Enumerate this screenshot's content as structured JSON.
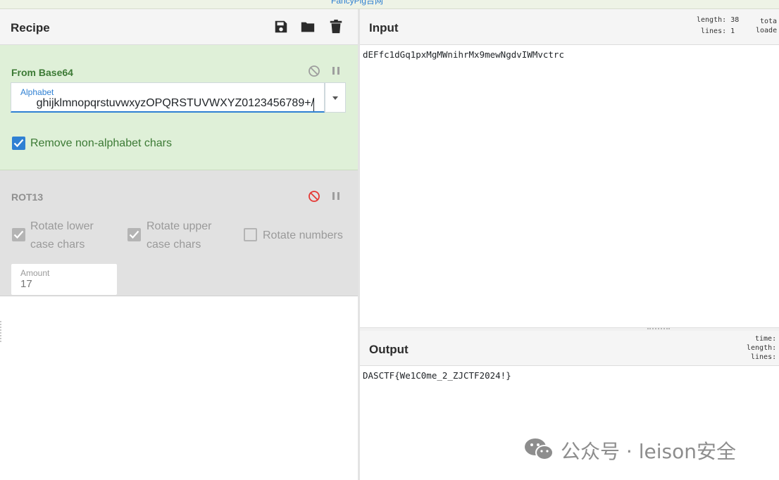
{
  "top_banner": {
    "text": "FancyPig台网"
  },
  "recipe": {
    "title": "Recipe",
    "icons": [
      "save-icon",
      "folder-open-icon",
      "trash-icon"
    ],
    "operations": [
      {
        "name": "From Base64",
        "enabled": true,
        "alphabet_label": "Alphabet",
        "alphabet_value": "ghijklmnopqrstuvwxyzOPQRSTUVWXYZ0123456789+/",
        "remove_non_alpha_label": "Remove non-alphabet chars",
        "remove_non_alpha_checked": true
      },
      {
        "name": "ROT13",
        "enabled": false,
        "rotate_lower_label_1": "Rotate lower",
        "rotate_lower_label_2": "case chars",
        "rotate_lower_checked": true,
        "rotate_upper_label_1": "Rotate upper",
        "rotate_upper_label_2": "case chars",
        "rotate_upper_checked": true,
        "rotate_numbers_label": "Rotate numbers",
        "rotate_numbers_checked": false,
        "amount_label": "Amount",
        "amount_value": "17"
      }
    ]
  },
  "input": {
    "title": "Input",
    "length_label": "length:",
    "length_value": "38",
    "lines_label": "lines:",
    "lines_value": "1",
    "total_label": "tota",
    "loaded_label": "loade",
    "text": "dEFfc1dGq1pxMgMWnihrMx9mewNgdvIWMvctrc"
  },
  "output": {
    "title": "Output",
    "time_label": "time:",
    "length_label": "length:",
    "lines_label": "lines:",
    "text": "DASCTF{We1C0me_2_ZJCTF2024!}"
  },
  "watermark": {
    "text": "公众号 · leison安全"
  },
  "colors": {
    "accent_blue": "#2f80d3",
    "op_enabled_bg": "#dff0d8",
    "op_enabled_text": "#3c7a35",
    "op_disabled_bg": "#e1e1e1",
    "disable_icon_red": "#e53935"
  }
}
